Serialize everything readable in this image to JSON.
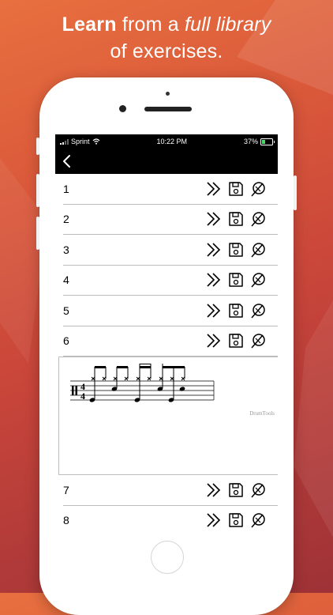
{
  "headline": {
    "learn": "Learn",
    "part1": " from a ",
    "emphasis": "full library",
    "line2": "of exercises."
  },
  "status_bar": {
    "carrier": "Sprint",
    "time": "10:22 PM",
    "battery": "37%",
    "battery_level": 0.37
  },
  "nav": {
    "back_icon": "chevron-left-icon"
  },
  "exercises_top": [
    {
      "label": "1"
    },
    {
      "label": "2"
    },
    {
      "label": "3"
    },
    {
      "label": "4"
    },
    {
      "label": "5"
    },
    {
      "label": "6"
    }
  ],
  "exercises_bottom": [
    {
      "label": "7"
    },
    {
      "label": "8"
    }
  ],
  "row_actions": [
    "double-chevron-right-icon",
    "save-disk-icon",
    "metronome-slash-icon"
  ],
  "notation": {
    "time_signature_top": "4",
    "time_signature_bottom": "4",
    "credit": "DrumTools"
  },
  "colors": {
    "background_top": "#e8703f",
    "background_bottom": "#9e3236",
    "screen_bar": "#000000",
    "battery_charging": "#4cd964"
  }
}
